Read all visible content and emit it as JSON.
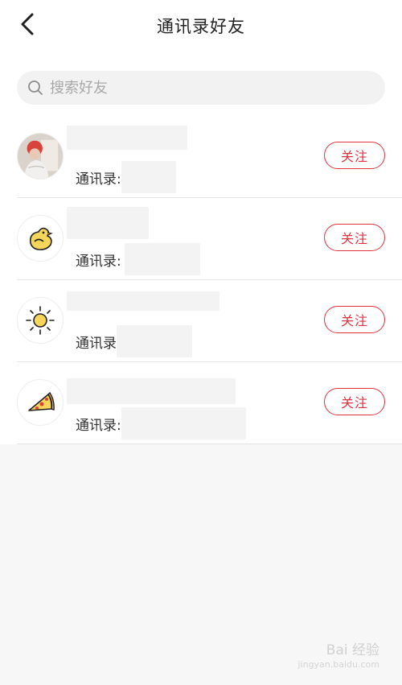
{
  "header": {
    "title": "通讯录好友",
    "back_icon": "chevron-left-icon"
  },
  "search": {
    "placeholder": "搜索好友",
    "value": "",
    "icon": "search-icon"
  },
  "contacts": [
    {
      "name": "",
      "contact_label": "通讯录:",
      "contact_value": "",
      "avatar": "photo-avatar",
      "follow_label": "关注"
    },
    {
      "name": "",
      "contact_label": "通讯录:",
      "contact_value": "",
      "avatar": "chick-avatar-icon",
      "follow_label": "关注"
    },
    {
      "name": "",
      "contact_label": "通讯录",
      "contact_value": "",
      "avatar": "sun-avatar-icon",
      "follow_label": "关注"
    },
    {
      "name": "",
      "contact_label": "通讯录:",
      "contact_value": "",
      "avatar": "pizza-avatar-icon",
      "follow_label": "关注"
    }
  ],
  "colors": {
    "accent": "#e0323f",
    "background": "#f7f7f7",
    "search_bg": "#f2f2f2"
  },
  "watermark": {
    "text": "Bai 经验",
    "sub": "jingyan.baidu.com"
  }
}
